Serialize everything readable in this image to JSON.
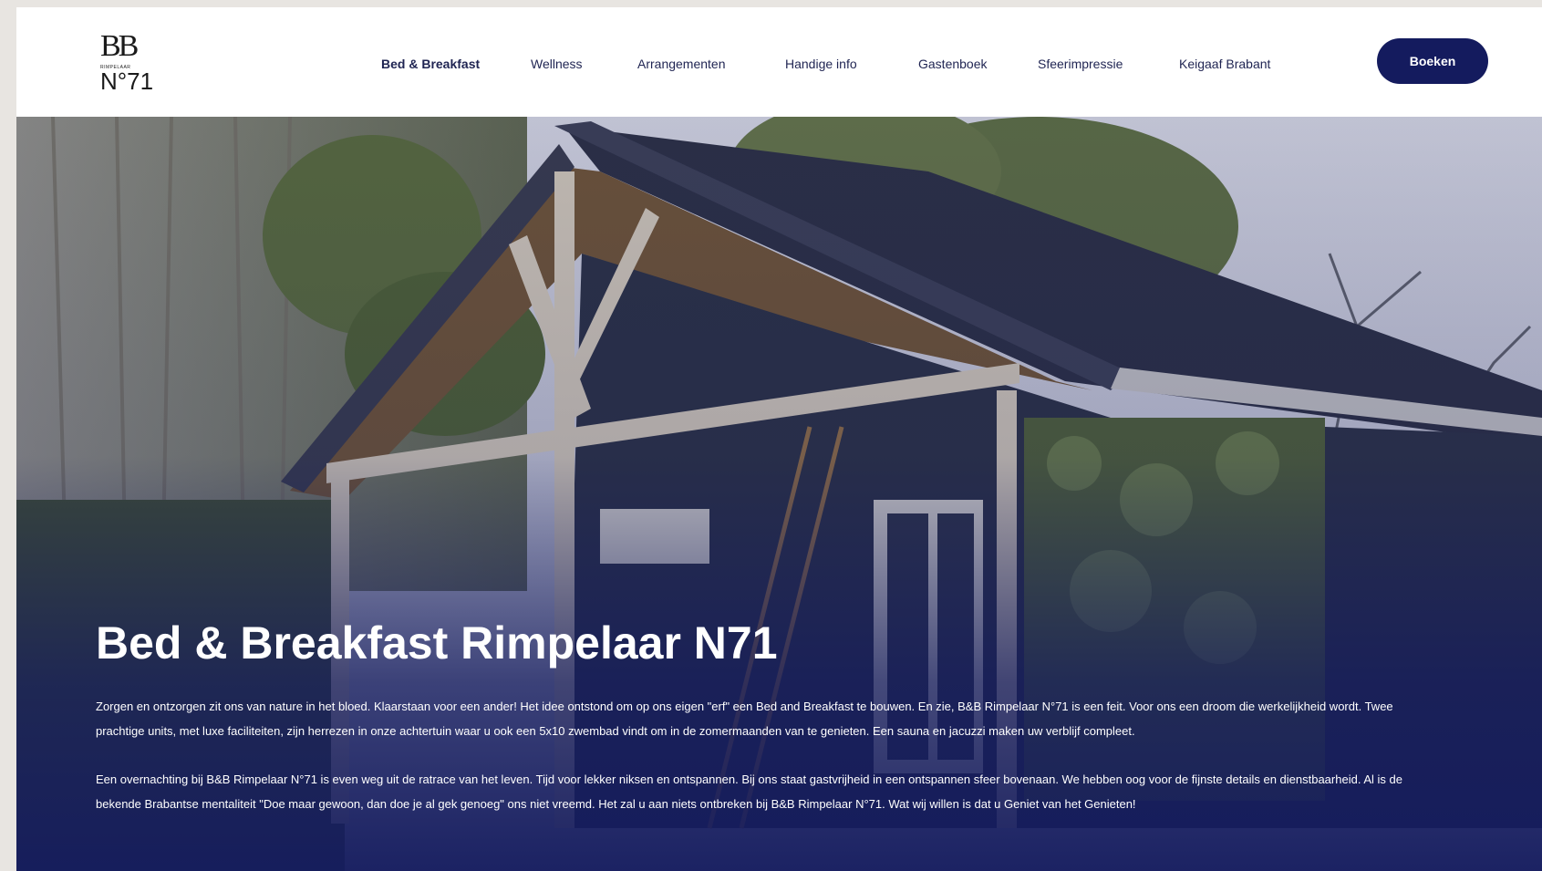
{
  "logo": {
    "letters": "BB",
    "small_text": "RIMPELAAR",
    "number": "N°71"
  },
  "nav": {
    "items": [
      {
        "label": "Bed & Breakfast",
        "active": true
      },
      {
        "label": "Wellness",
        "active": false
      },
      {
        "label": "Arrangementen",
        "active": false
      },
      {
        "label": "Handige info",
        "active": false
      },
      {
        "label": "Gastenboek",
        "active": false
      },
      {
        "label": "Sfeerimpressie",
        "active": false
      },
      {
        "label": "Keigaaf Brabant",
        "active": false
      }
    ],
    "book_label": "Boeken"
  },
  "hero": {
    "title": "Bed & Breakfast Rimpelaar N71",
    "paragraph1": "Zorgen en ontzorgen zit ons van nature in het bloed. Klaarstaan voor een ander! Het idee ontstond om op ons eigen \"erf\" een Bed and Breakfast te bouwen. En zie, B&B Rimpelaar N°71 is een feit. Voor ons een droom die werkelijkheid wordt. Twee prachtige units, met luxe faciliteiten, zijn herrezen in onze achtertuin waar u ook een 5x10 zwembad vindt om in de zomermaanden van te genieten. Een sauna en jacuzzi maken uw verblijf compleet.",
    "paragraph2": "Een overnachting bij B&B Rimpelaar N°71 is even weg uit de ratrace van het leven. Tijd voor lekker niksen en ontspannen. Bij ons staat gastvrijheid in een ontspannen sfeer bovenaan. We hebben oog voor de fijnste details en dienstbaarheid. Al is de bekende Brabantse mentaliteit \"Doe maar gewoon, dan doe je al gek genoeg\" ons niet vreemd. Het zal u aan niets ontbreken bij B&B Rimpelaar N°71. Wat wij willen is dat u Geniet van het Genieten!"
  },
  "colors": {
    "brand_navy": "#141b5e",
    "nav_text": "#1f2452",
    "frame_bg": "#e8e5e1"
  }
}
